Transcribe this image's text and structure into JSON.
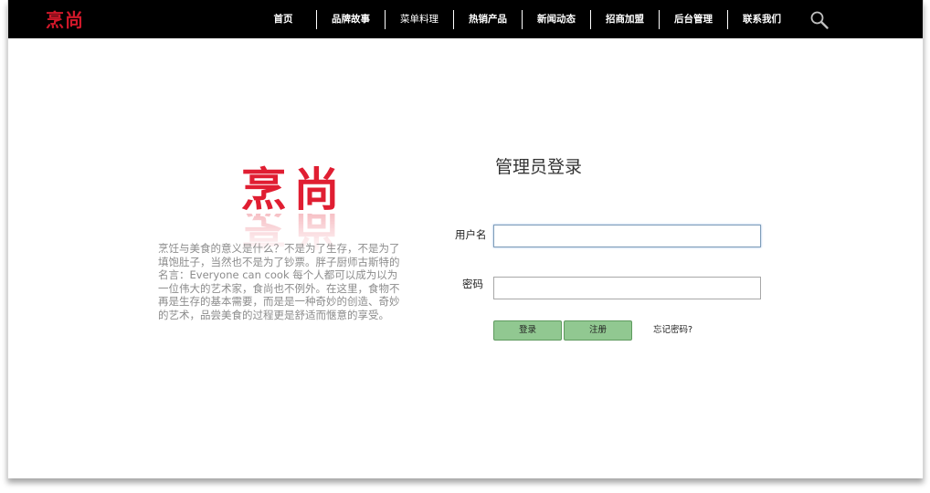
{
  "nav": {
    "logo": "烹尚",
    "items": [
      {
        "key": "home",
        "label": "首页"
      },
      {
        "key": "brand-story",
        "label": "品牌故事"
      },
      {
        "key": "menu",
        "label": "菜单料理"
      },
      {
        "key": "hot-products",
        "label": "热销产品"
      },
      {
        "key": "news",
        "label": "新闻动态"
      },
      {
        "key": "franchise",
        "label": "招商加盟"
      },
      {
        "key": "admin",
        "label": "后台管理"
      },
      {
        "key": "contact",
        "label": "联系我们"
      }
    ],
    "search_icon": "search-icon"
  },
  "brand": {
    "logo_text": "烹尚",
    "intro": "烹饪与美食的意义是什么？不是为了生存，不是为了填饱肚子，当然也不是为了钞票。胖子厨师古斯特的名言：Everyone can cook 每个人都可以成为以为一位伟大的艺术家，食尚也不例外。在这里，食物不再是生存的基本需要，而是是一种奇妙的创造、奇妙的艺术，品尝美食的过程更是舒适而惬意的享受。"
  },
  "login": {
    "title": "管理员登录",
    "username_label": "用户名",
    "username_value": "",
    "password_label": "密码",
    "password_value": "",
    "login_button": "登录",
    "register_button": "注册",
    "forgot_link": "忘记密码?"
  },
  "colors": {
    "nav_bg": "#000000",
    "brand_red": "#e01e32",
    "button_green": "#91c891",
    "intro_text": "#8c8c8c"
  }
}
